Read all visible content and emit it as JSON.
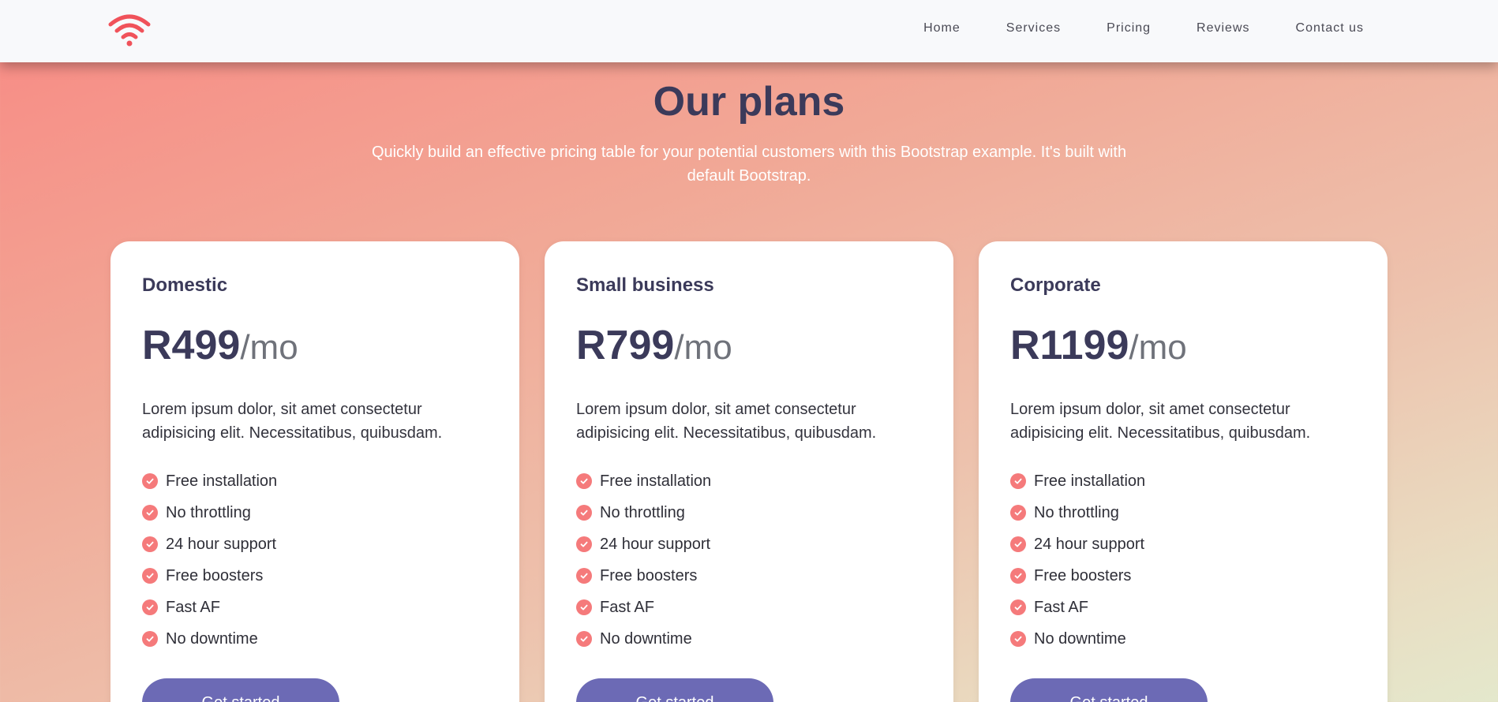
{
  "nav": {
    "logo_icon": "wifi-icon",
    "links": [
      "Home",
      "Services",
      "Pricing",
      "Reviews",
      "Contact us"
    ]
  },
  "header": {
    "title": "Our plans",
    "subtitle": "Quickly build an effective pricing table for your potential customers with this Bootstrap example. It's built with default Bootstrap."
  },
  "plans": [
    {
      "name": "Domestic",
      "price": "R499",
      "period": "/mo",
      "description": "Lorem ipsum dolor, sit amet consectetur adipisicing elit. Necessitatibus, quibusdam.",
      "features": [
        "Free installation",
        "No throttling",
        "24 hour support",
        "Free boosters",
        "Fast AF",
        "No downtime"
      ],
      "cta": "Get started"
    },
    {
      "name": "Small business",
      "price": "R799",
      "period": "/mo",
      "description": "Lorem ipsum dolor, sit amet consectetur adipisicing elit. Necessitatibus, quibusdam.",
      "features": [
        "Free installation",
        "No throttling",
        "24 hour support",
        "Free boosters",
        "Fast AF",
        "No downtime"
      ],
      "cta": "Get started"
    },
    {
      "name": "Corporate",
      "price": "R1199",
      "period": "/mo",
      "description": "Lorem ipsum dolor, sit amet consectetur adipisicing elit. Necessitatibus, quibusdam.",
      "features": [
        "Free installation",
        "No throttling",
        "24 hour support",
        "Free boosters",
        "Fast AF",
        "No downtime"
      ],
      "cta": "Get started"
    }
  ],
  "colors": {
    "accent": "#f57a7b",
    "button": "#6c6ab5",
    "heading": "#3b3a5a"
  }
}
